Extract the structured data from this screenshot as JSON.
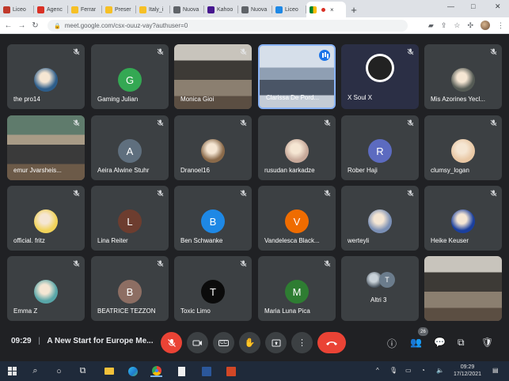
{
  "browser": {
    "tabs": [
      {
        "label": "Liceo",
        "color": "#c0392b"
      },
      {
        "label": "Agenc",
        "color": "#d93025"
      },
      {
        "label": "Ferrar",
        "color": "#f6c026"
      },
      {
        "label": "Preser",
        "color": "#f6c026"
      },
      {
        "label": "Italy_i",
        "color": "#f6c026"
      },
      {
        "label": "Nuova",
        "color": "#5f6368"
      },
      {
        "label": "Kahoo",
        "color": "#46178f"
      },
      {
        "label": "Nuova",
        "color": "#5f6368"
      },
      {
        "label": "Liceo",
        "color": "#1e88e5"
      }
    ],
    "active_tab": {
      "close": "×"
    },
    "new_tab": "+",
    "url": "meet.google.com/csx-ouuz-vay?authuser=0"
  },
  "participants": [
    {
      "name": "the pro14",
      "type": "avatar",
      "avatar_color": "#2d5d8a"
    },
    {
      "name": "Gaming Julian",
      "type": "letter",
      "letter": "G",
      "avatar_color": "#34a853"
    },
    {
      "name": "Monica Gioi",
      "type": "video"
    },
    {
      "name": "Clarissa De Pord...",
      "type": "video-speaking"
    },
    {
      "name": "X Soul X",
      "type": "obs"
    },
    {
      "name": "Mis Azorines Yecl...",
      "type": "avatar",
      "avatar_color": "#555b55"
    },
    {
      "name": "emur Jvarsheis...",
      "type": "video"
    },
    {
      "name": "Aeira Alwine Stuhr",
      "type": "letter",
      "letter": "A",
      "avatar_color": "#5f6f7e"
    },
    {
      "name": "Dranoel16",
      "type": "avatar",
      "avatar_color": "#8a6a4a"
    },
    {
      "name": "rusudan karkadze",
      "type": "avatar",
      "avatar_color": "#c7a99a"
    },
    {
      "name": "Rober Haji",
      "type": "letter",
      "letter": "R",
      "avatar_color": "#5c6bc0"
    },
    {
      "name": "clumsy_logan",
      "type": "avatar",
      "avatar_color": "#e9c8a5"
    },
    {
      "name": "official. fritz",
      "type": "avatar",
      "avatar_color": "#f1d35a"
    },
    {
      "name": "Lina Reiter",
      "type": "letter",
      "letter": "L",
      "avatar_color": "#6d3d2f"
    },
    {
      "name": "Ben Schwanke",
      "type": "letter",
      "letter": "B",
      "avatar_color": "#1e88e5"
    },
    {
      "name": "Vandelesca Black...",
      "type": "letter",
      "letter": "V",
      "avatar_color": "#ef6c00"
    },
    {
      "name": "werteyli",
      "type": "avatar",
      "avatar_color": "#7a8fb5"
    },
    {
      "name": "Heike Keuser",
      "type": "avatar",
      "avatar_color": "#1a3f9e"
    },
    {
      "name": "Emma Z",
      "type": "avatar",
      "avatar_color": "#58a6a8"
    },
    {
      "name": "BEATRICE TEZZON",
      "type": "letter",
      "letter": "B",
      "avatar_color": "#8d6e63"
    },
    {
      "name": "Toxic Limo",
      "type": "letter",
      "letter": "T",
      "avatar_color": "#0b0b0b"
    },
    {
      "name": "Maria Luna Pica",
      "type": "letter",
      "letter": "M",
      "avatar_color": "#2e7d32"
    },
    {
      "name": "Altri 3",
      "type": "others",
      "letter": "T"
    },
    {
      "name": "",
      "type": "video"
    }
  ],
  "meeting": {
    "time": "09:29",
    "separator": "|",
    "title": "A New Start for Europe Me...",
    "participant_count": "26"
  },
  "controls": {
    "mic": "mic-off",
    "camera": "camera",
    "captions": "CC",
    "raise_hand": "hand",
    "present": "present",
    "more": "⋮",
    "hangup": "end-call"
  },
  "taskbar": {
    "time": "09:29",
    "date": "17/12/2021"
  }
}
